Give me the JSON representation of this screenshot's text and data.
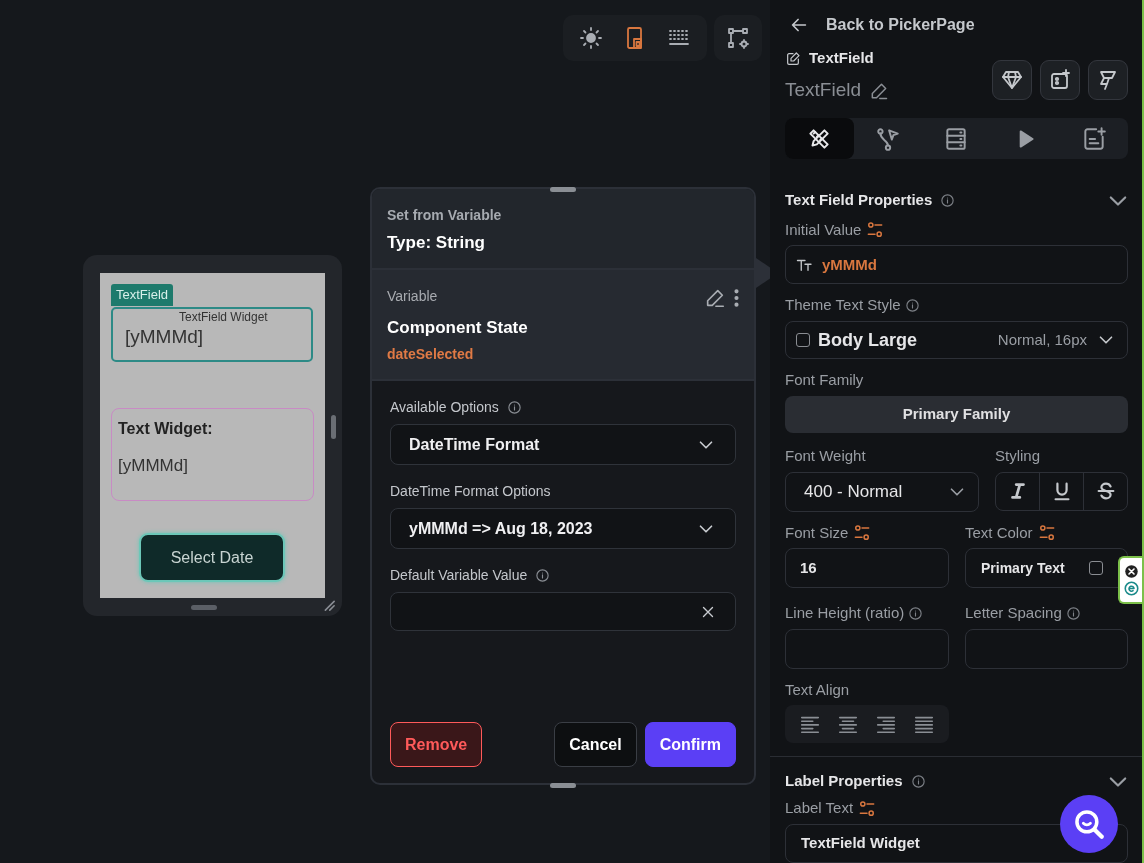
{
  "canvas_toolbar": [
    {
      "kind": "theme",
      "selected": false
    },
    {
      "kind": "device",
      "selected": true
    },
    {
      "kind": "grid",
      "selected": false
    },
    {
      "kind": "flow",
      "selected": false
    }
  ],
  "phone": {
    "tag": "TextField",
    "text_field_label": "TextField Widget",
    "text_field_value": "[yMMMd]",
    "text_title": "Text Widget:",
    "text_value": "[yMMMd]",
    "button": "Select Date"
  },
  "variable_dialog": {
    "header_label": "Set from Variable",
    "type": "Type: String",
    "variable_label": "Variable",
    "variable_source": "Component State",
    "variable_name": "dateSelected",
    "fields": [
      {
        "kind": "dropdown",
        "label": "Available Options",
        "info": true,
        "value": "DateTime Format"
      },
      {
        "kind": "dropdown",
        "label": "DateTime Format Options",
        "info": false,
        "value": "yMMMd => Aug 18, 2023"
      },
      {
        "kind": "clearable",
        "label": "Default Variable Value",
        "info": true
      }
    ],
    "buttons": [
      {
        "kind": "danger",
        "label": "Remove"
      },
      {
        "kind": "secondary",
        "label": "Cancel"
      },
      {
        "kind": "primary",
        "label": "Confirm"
      }
    ]
  },
  "properties_panel": {
    "back": "Back to PickerPage",
    "widget_type": "TextField",
    "widget_name": "TextField",
    "tabs": [
      {
        "kind": "properties",
        "selected": true
      },
      {
        "kind": "actions",
        "selected": false
      },
      {
        "kind": "backend",
        "selected": false
      },
      {
        "kind": "animation",
        "selected": false
      },
      {
        "kind": "notes",
        "selected": false
      }
    ],
    "text_field_section": {
      "title": "Text Field Properties",
      "expanded": true,
      "initial_value_label": "Initial Value",
      "initial_value": "yMMMd",
      "theme_style_label": "Theme Text Style",
      "theme_style": "Body Large",
      "theme_style_checked": false,
      "theme_style_detail": "Normal, 16px",
      "font_family_label": "Font Family",
      "font_family": "Primary Family",
      "font_weight_label": "Font Weight",
      "font_weight": "400 - Normal",
      "styling_label": "Styling",
      "styling": [
        {
          "kind": "italic"
        },
        {
          "kind": "underline"
        },
        {
          "kind": "strikethrough"
        }
      ],
      "font_size_label": "Font Size",
      "font_size": "16",
      "text_color_label": "Text Color",
      "text_color": "Primary Text",
      "text_color_checked": false,
      "line_height_label": "Line Height (ratio)",
      "letter_spacing_label": "Letter Spacing",
      "text_align_label": "Text Align",
      "text_align": [
        {
          "kind": "left"
        },
        {
          "kind": "center"
        },
        {
          "kind": "right"
        },
        {
          "kind": "justify"
        }
      ]
    },
    "label_section": {
      "title": "Label Properties",
      "expanded": true,
      "label_text_label": "Label Text",
      "label_text": "TextField Widget"
    }
  }
}
